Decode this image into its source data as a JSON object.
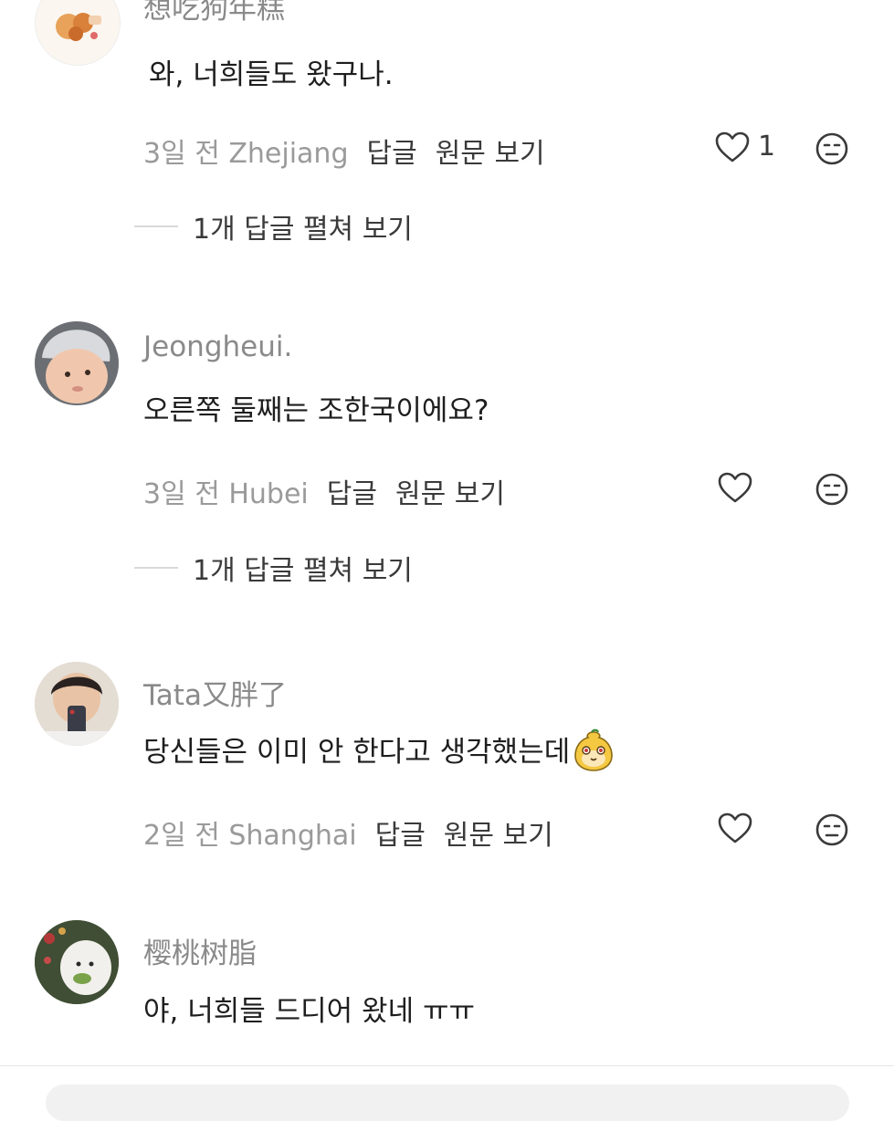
{
  "comments": [
    {
      "username": "想吃狗年糕",
      "text": "와, 너희들도 왔구나.",
      "date_location": "3일 전 Zhejiang",
      "reply_label": "답글",
      "original_label": "원문 보기",
      "like_count": "1",
      "expand_label": "1개 답글 펼쳐 보기"
    },
    {
      "username": "Jeongheui.",
      "text": "오른쪽 둘째는 조한국이에요?",
      "date_location": "3일 전 Hubei",
      "reply_label": "답글",
      "original_label": "원문 보기",
      "expand_label": "1개 답글 펼쳐 보기"
    },
    {
      "username": "Tata又胖了",
      "text": "당신들은 이미 안 한다고 생각했는데",
      "date_location": "2일 전 Shanghai",
      "reply_label": "답글",
      "original_label": "원문 보기"
    },
    {
      "username": "樱桃树脂",
      "text": "야, 너희들 드디어 왔네 ㅠㅠ"
    }
  ],
  "icons": {
    "like": "heart-outline-icon",
    "emoji_reaction": "neutral-face-icon",
    "inline_emoji": "yellow-mascot-emoji"
  },
  "colors": {
    "username": "#8a8a8a",
    "text": "#1e1e1e",
    "meta_date": "#9a9a9a",
    "meta_action": "#3a3a3a"
  }
}
